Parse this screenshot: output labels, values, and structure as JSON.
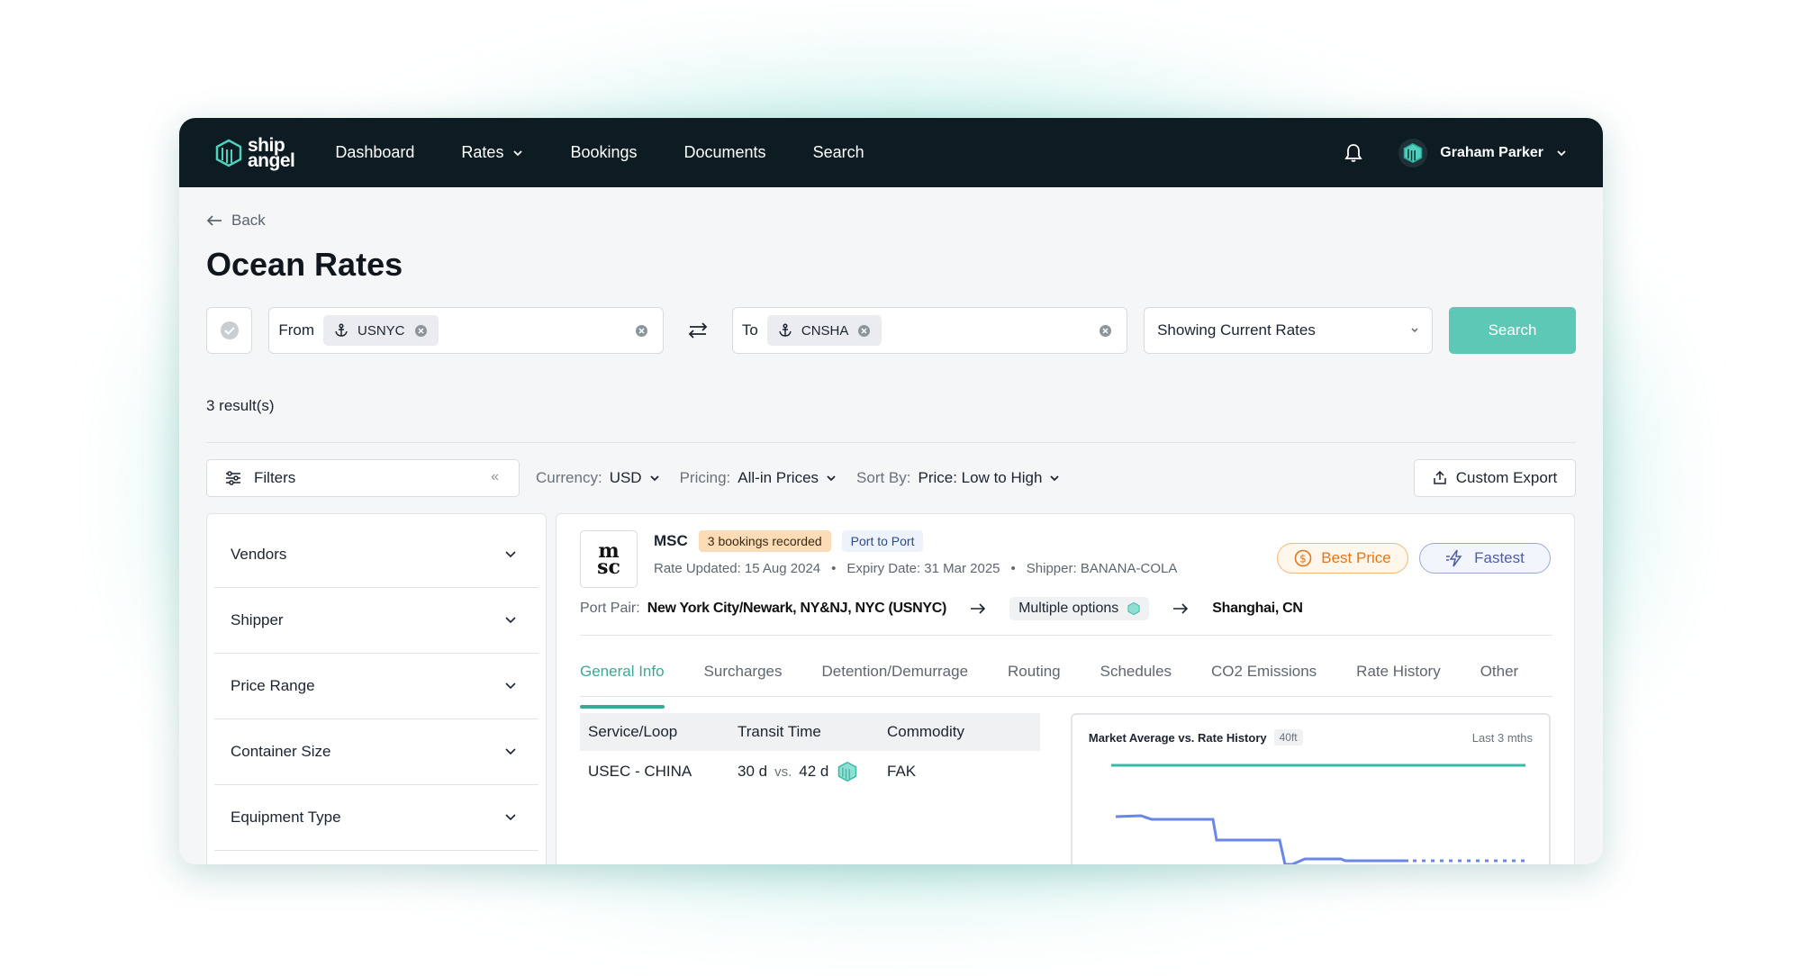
{
  "nav": {
    "logo_line1": "ship",
    "logo_line2": "angel",
    "items": [
      "Dashboard",
      "Rates",
      "Bookings",
      "Documents",
      "Search"
    ],
    "user_name": "Graham Parker"
  },
  "page": {
    "back_label": "Back",
    "title": "Ocean Rates"
  },
  "search": {
    "from_label": "From",
    "from_port": "USNYC",
    "to_label": "To",
    "to_port": "CNSHA",
    "rates_mode": "Showing Current Rates",
    "search_label": "Search"
  },
  "results": {
    "count_label": "3 result(s)"
  },
  "toolbar": {
    "filters_label": "Filters",
    "currency_key": "Currency:",
    "currency_value": "USD",
    "pricing_key": "Pricing:",
    "pricing_value": "All-in Prices",
    "sort_key": "Sort By:",
    "sort_value": "Price: Low to High",
    "export_label": "Custom Export"
  },
  "filters": [
    "Vendors",
    "Shipper",
    "Price Range",
    "Container Size",
    "Equipment Type"
  ],
  "card": {
    "vendor_logo_top": "m",
    "vendor_logo_bottom": "sc",
    "vendor_name": "MSC",
    "bookings_badge": "3 bookings recorded",
    "route_badge": "Port to Port",
    "rate_updated": "Rate Updated: 15 Aug 2024",
    "expiry_date": "Expiry Date: 31 Mar 2025",
    "shipper": "Shipper: BANANA-COLA",
    "best_price_label": "Best Price",
    "fastest_label": "Fastest",
    "port_pair_key": "Port Pair:",
    "origin": "New York City/Newark, NY&NJ, NYC (USNYC)",
    "via": "Multiple options",
    "destination": "Shanghai, CN",
    "tabs": [
      "General Info",
      "Surcharges",
      "Detention/Demurrage",
      "Routing",
      "Schedules",
      "CO2 Emissions",
      "Rate History",
      "Other"
    ],
    "table": {
      "headers": [
        "Service/Loop",
        "Transit Time",
        "Commodity"
      ],
      "row": {
        "service": "USEC - CHINA",
        "transit": "30 d",
        "vs": "vs.",
        "market_transit": "42 d",
        "commodity": "FAK"
      }
    },
    "chart": {
      "title": "Market Average vs. Rate History",
      "tag": "40ft",
      "period": "Last 3 mths"
    }
  },
  "colors": {
    "accent": "#5cc8b6",
    "nav_bg": "#0d1b22",
    "best_price": "#e2761b",
    "fastest": "#4d5fa6",
    "rate_line": "#6a86e8",
    "market_line": "#3ab8a5"
  }
}
